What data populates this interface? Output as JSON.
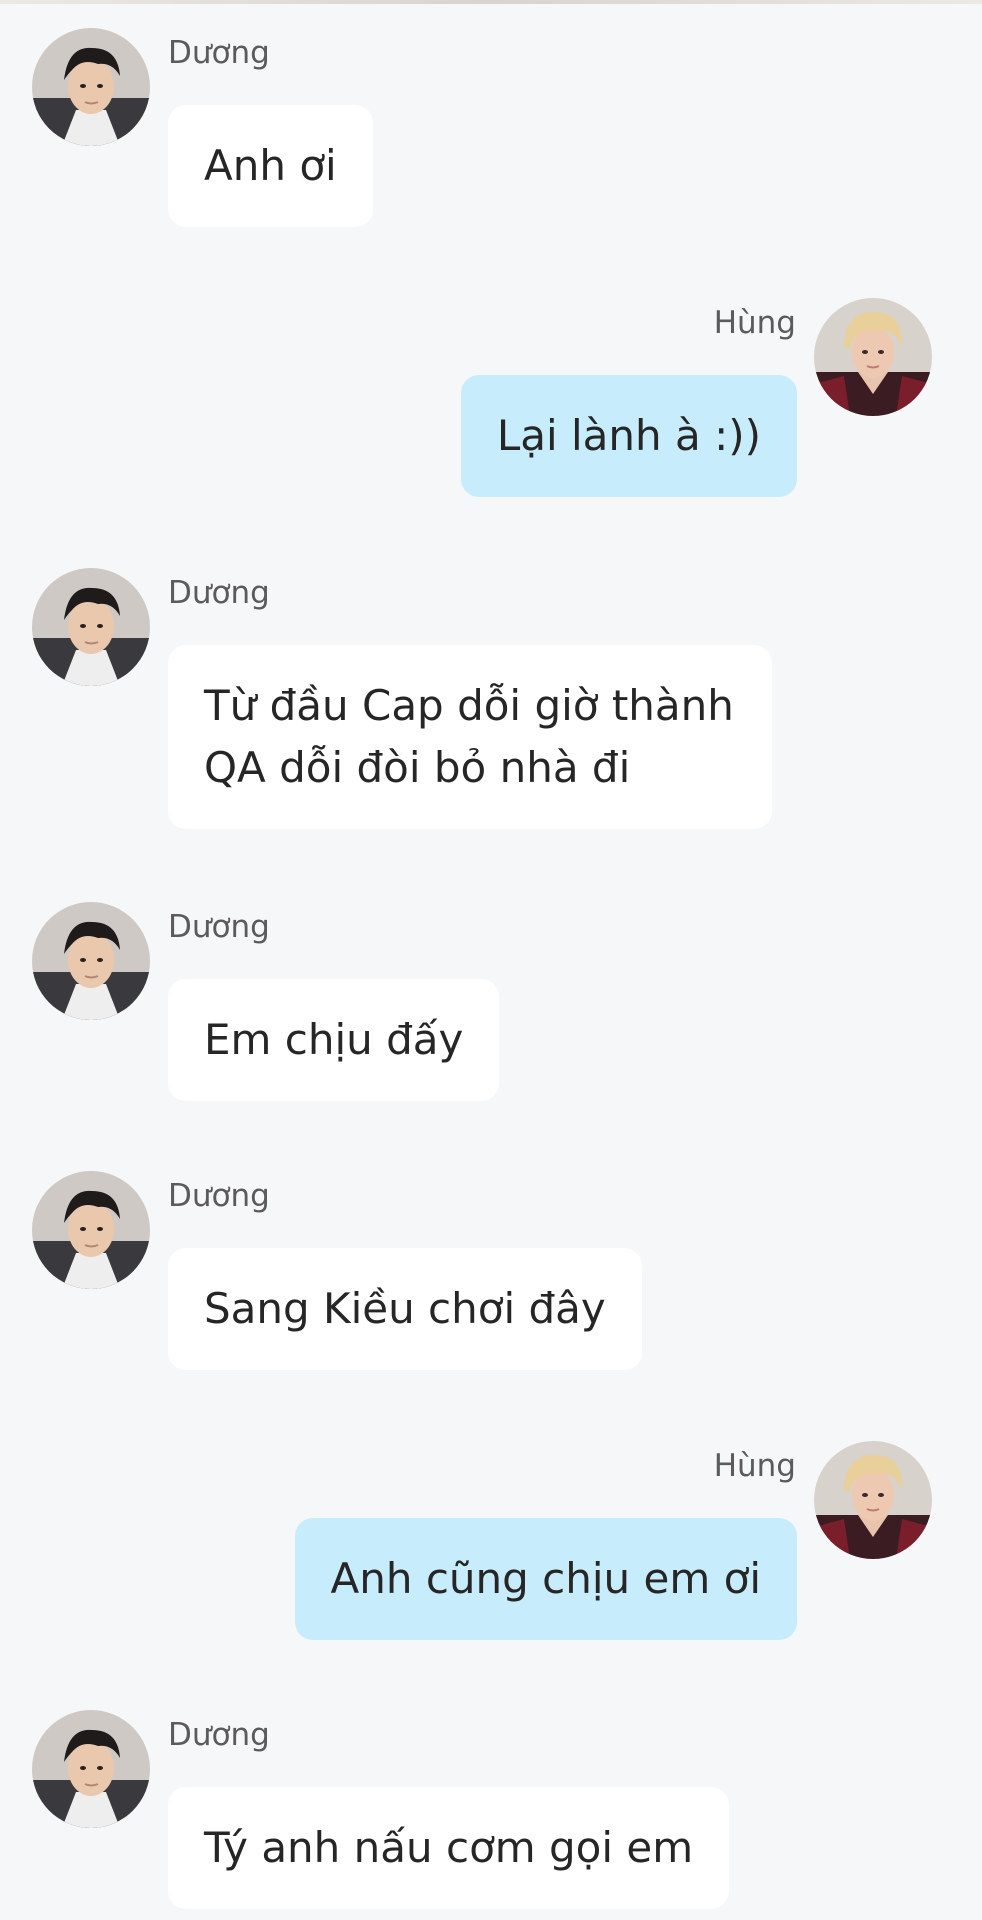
{
  "conversation": {
    "messages": [
      {
        "sender": "Dương",
        "text": "Anh ơi",
        "side": "incoming",
        "avatar_icon": "duong-avatar"
      },
      {
        "sender": "Hùng",
        "text": "Lại lành à :))",
        "side": "outgoing",
        "avatar_icon": "hung-avatar"
      },
      {
        "sender": "Dương",
        "text": "Từ đầu Cap dỗi giờ thành QA dỗi đòi bỏ nhà đi",
        "side": "incoming",
        "avatar_icon": "duong-avatar"
      },
      {
        "sender": "Dương",
        "text": "Em chịu đấy",
        "side": "incoming",
        "avatar_icon": "duong-avatar"
      },
      {
        "sender": "Dương",
        "text": "Sang Kiều chơi đây",
        "side": "incoming",
        "avatar_icon": "duong-avatar"
      },
      {
        "sender": "Hùng",
        "text": "Anh cũng chịu em ơi",
        "side": "outgoing",
        "avatar_icon": "hung-avatar"
      },
      {
        "sender": "Dương",
        "text": "Tý anh nấu cơm gọi em",
        "side": "incoming",
        "avatar_icon": "duong-avatar"
      }
    ]
  },
  "colors": {
    "background": "#f6f7f9",
    "incoming_bubble": "#ffffff",
    "outgoing_bubble": "#c7ecfb",
    "sender_name": "#5b5b5b",
    "message_text": "#262626"
  }
}
